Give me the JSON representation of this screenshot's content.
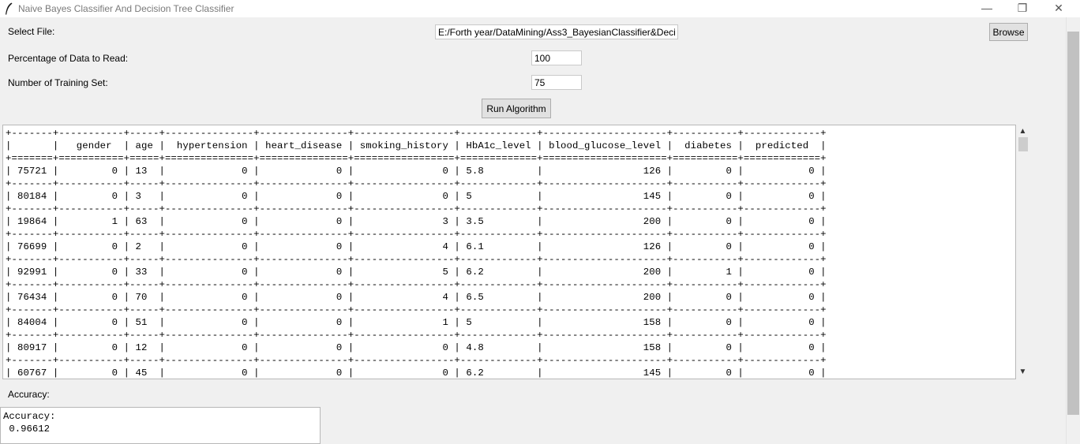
{
  "window": {
    "title": "Naive Bayes Classifier And Decision Tree Classifier",
    "icon": "feather-icon",
    "controls": {
      "minimize": "—",
      "maximize": "❐",
      "close": "✕"
    }
  },
  "form": {
    "select_file_label": "Select File:",
    "file_path_value": "E:/Forth year/DataMining/Ass3_BayesianClassifier&Decisi",
    "browse_label": "Browse",
    "percentage_label": "Percentage of Data to Read:",
    "percentage_value": "100",
    "training_label": "Number of Training Set:",
    "training_value": "75",
    "run_label": "Run Algorithm"
  },
  "table": {
    "columns": [
      "",
      "gender",
      "age",
      "hypertension",
      "heart_disease",
      "smoking_history",
      "HbA1c_level",
      "blood_glucose_level",
      "diabetes",
      "predicted"
    ],
    "rows": [
      [
        "75721",
        "0",
        "13",
        "0",
        "0",
        "0",
        "5.8",
        "126",
        "0",
        "0"
      ],
      [
        "80184",
        "0",
        "3",
        "0",
        "0",
        "0",
        "5",
        "145",
        "0",
        "0"
      ],
      [
        "19864",
        "1",
        "63",
        "0",
        "0",
        "3",
        "3.5",
        "200",
        "0",
        "0"
      ],
      [
        "76699",
        "0",
        "2",
        "0",
        "0",
        "4",
        "6.1",
        "126",
        "0",
        "0"
      ],
      [
        "92991",
        "0",
        "33",
        "0",
        "0",
        "5",
        "6.2",
        "200",
        "1",
        "0"
      ],
      [
        "76434",
        "0",
        "70",
        "0",
        "0",
        "4",
        "6.5",
        "200",
        "0",
        "0"
      ],
      [
        "84004",
        "0",
        "51",
        "0",
        "0",
        "1",
        "5",
        "158",
        "0",
        "0"
      ],
      [
        "80917",
        "0",
        "12",
        "0",
        "0",
        "0",
        "4.8",
        "158",
        "0",
        "0"
      ],
      [
        "60767",
        "0",
        "45",
        "0",
        "0",
        "0",
        "6.2",
        "145",
        "0",
        "0"
      ]
    ]
  },
  "accuracy": {
    "label": "Accuracy:",
    "output": "Accuracy:\n 0.96612"
  }
}
